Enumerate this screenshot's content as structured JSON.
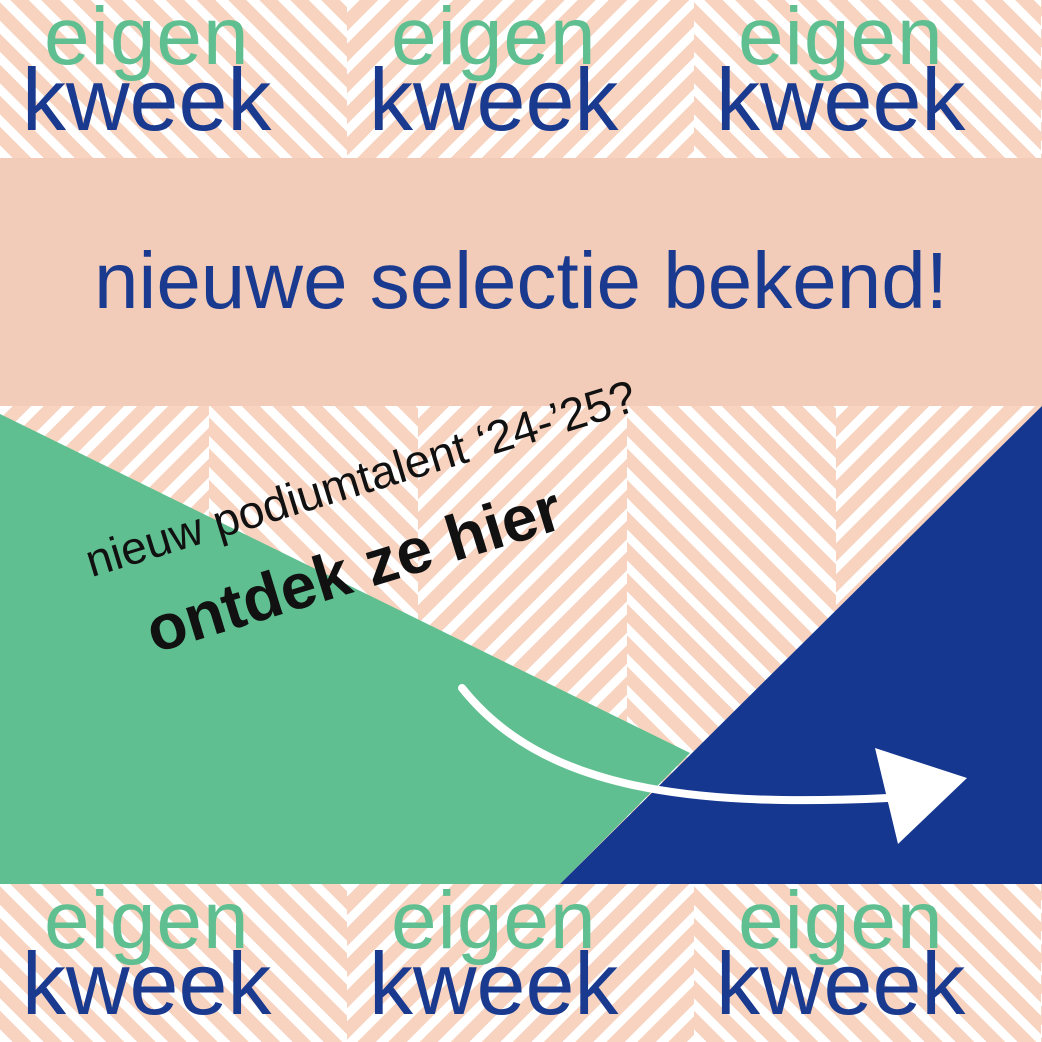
{
  "logo": {
    "word1": "eigen",
    "word2": "kweek",
    "repeat": 3
  },
  "headline": "nieuwe selectie bekend!",
  "tagline": {
    "line1": "nieuw podiumtalent ‘24-’25?",
    "line2": "ontdek ze hier"
  },
  "icons": {
    "arrow": "curved-arrow-right-icon"
  },
  "colors": {
    "blue": "#1a3a8f",
    "green": "#5fbf90",
    "peach": "#f2ccb8",
    "stripe_light": "#ffffff"
  }
}
